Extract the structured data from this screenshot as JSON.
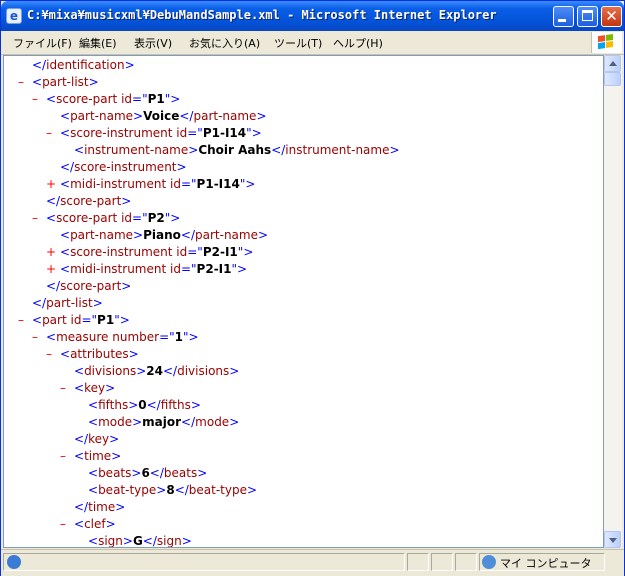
{
  "window": {
    "title": "C:¥mixa¥musicxml¥DebuMandSample.xml - Microsoft Internet Explorer",
    "min_glyph": "",
    "close_glyph": "✕"
  },
  "menu": [
    "ファイル(F)",
    "編集(E)",
    "表示(V)",
    "お気に入り(A)",
    "ツール(T)",
    "ヘルプ(H)"
  ],
  "xml_lines": [
    {
      "t": "",
      "tag": "</identification>"
    },
    {
      "t": "-",
      "tag": "<part-list>"
    },
    {
      "t": "-",
      "tag": "<score-part id=\"P1\">"
    },
    {
      "t": "",
      "tag": "<part-name>Voice</part-name>"
    },
    {
      "t": "-",
      "tag": "<score-instrument id=\"P1-I14\">"
    },
    {
      "t": "",
      "tag": "<instrument-name>Choir Aahs</instrument-name>"
    },
    {
      "t": "",
      "tag": "</score-instrument>"
    },
    {
      "t": "+",
      "tag": "<midi-instrument id=\"P1-I14\">"
    },
    {
      "t": "",
      "tag": "</score-part>"
    },
    {
      "t": "-",
      "tag": "<score-part id=\"P2\">"
    },
    {
      "t": "",
      "tag": "<part-name>Piano</part-name>"
    },
    {
      "t": "+",
      "tag": "<score-instrument id=\"P2-I1\">"
    },
    {
      "t": "+",
      "tag": "<midi-instrument id=\"P2-I1\">"
    },
    {
      "t": "",
      "tag": "</score-part>"
    },
    {
      "t": "",
      "tag": "</part-list>"
    },
    {
      "t": "-",
      "tag": "<part id=\"P1\">"
    },
    {
      "t": "-",
      "tag": "<measure number=\"1\">"
    },
    {
      "t": "-",
      "tag": "<attributes>"
    },
    {
      "t": "",
      "tag": "<divisions>24</divisions>"
    },
    {
      "t": "-",
      "tag": "<key>"
    },
    {
      "t": "",
      "tag": "<fifths>0</fifths>"
    },
    {
      "t": "",
      "tag": "<mode>major</mode>"
    },
    {
      "t": "",
      "tag": "</key>"
    },
    {
      "t": "-",
      "tag": "<time>"
    },
    {
      "t": "",
      "tag": "<beats>6</beats>"
    },
    {
      "t": "",
      "tag": "<beat-type>8</beat-type>"
    },
    {
      "t": "",
      "tag": "</time>"
    },
    {
      "t": "-",
      "tag": "<clef>"
    },
    {
      "t": "",
      "tag": "<sign>G</sign>"
    }
  ],
  "status": {
    "zone_text": "マイ コンピュータ"
  }
}
